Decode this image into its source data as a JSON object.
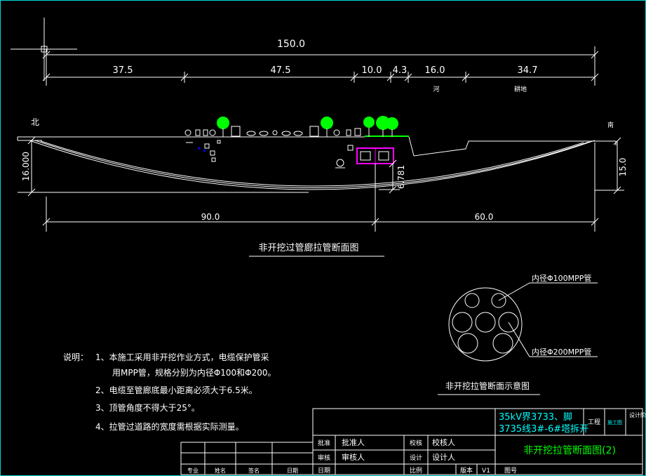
{
  "colors": {
    "background": "#000000",
    "line": "#ffffff",
    "frame": "#00d8d8",
    "tree": "#00ff00",
    "ground_green": "#00ff00",
    "pipe_box": "#ff00ff",
    "title_cyan": "#00ffff",
    "chart_title_green": "#00ff00",
    "small_blue": "#0000ff"
  },
  "dimensions": {
    "total_length": "150.0",
    "segments": [
      "37.5",
      "47.5",
      "10.0",
      "4.3",
      "16.0",
      "34.7"
    ],
    "bottom_left": "90.0",
    "bottom_right": "60.0",
    "depth_left": "16.000",
    "depth_right": "15.0",
    "depth_mid": "6.781"
  },
  "labels": {
    "north": "北",
    "south": "南",
    "river": "河",
    "field": "耕地",
    "section_title": "非开挖过管廊拉管断面图",
    "pipe_section_title": "非开挖拉管断面示意图",
    "pipe_small": "内径Φ100MPP管",
    "pipe_large": "内径Φ200MPP管"
  },
  "notes": {
    "head": "说明：",
    "items": [
      "1、本施工采用非开挖作业方式，电缆保护管采",
      "用MPP管，规格分别为内径Φ100和Φ200。",
      "2、电缆至管廊底最小距离必须大于6.5米。",
      "3、顶管角度不得大于25°。",
      "4、拉管过道路的宽度需根据实际测量。"
    ]
  },
  "title_block": {
    "project_line1": "35kV界3733、脚",
    "project_line2": "3735线3#-6#塔拆开",
    "project_tag": "工程",
    "stage_tag": "施工图",
    "stage_label": "设计阶段",
    "drawing_title": "非开挖拉管断面图(2)",
    "approve_label": "批准",
    "approve_person": "批准人",
    "check_label": "校核",
    "check_person": "校核人",
    "review_label": "审核",
    "review_person": "审核人",
    "design_label": "设计",
    "design_person": "设计人",
    "date_label": "日期",
    "scale_label": "比例",
    "version_label": "版本",
    "version_value": "V1",
    "sheet_label": "图号"
  },
  "revision_table": {
    "headers": [
      "专业",
      "姓名",
      "签名",
      "日期"
    ]
  }
}
